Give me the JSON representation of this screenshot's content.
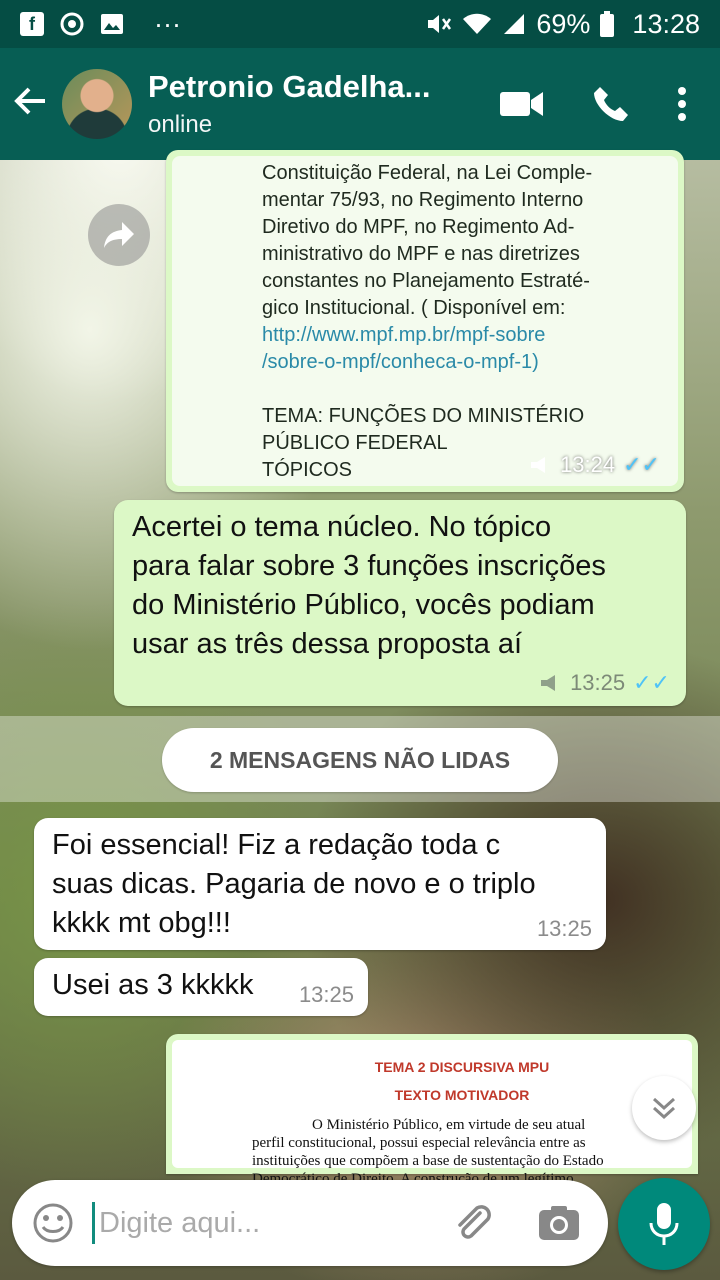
{
  "status_bar": {
    "icons": [
      "facebook-icon",
      "chrome-icon",
      "gallery-icon",
      "more-dots-icon"
    ],
    "more": "···",
    "battery": "69%",
    "time": "13:28"
  },
  "header": {
    "name": "Petronio Gadelha...",
    "presence": "online"
  },
  "messages": [
    {
      "type": "image",
      "direction": "out",
      "text_lines": [
        "Constituição Federal, na Lei Comple-",
        "mentar 75/93, no Regimento Interno",
        "Diretivo do MPF, no Regimento Ad-",
        "ministrativo do MPF e nas diretrizes",
        "constantes no Planejamento Estraté-",
        "gico Institucional.  ( Disponível em:",
        "http://www.mpf.mp.br/mpf-sobre",
        "/sobre-o-mpf/conheca-o-mpf-1)",
        "",
        "TEMA: FUNÇÕES DO MINISTÉRIO",
        "PÚBLICO FEDERAL",
        "TÓPICOS"
      ],
      "time": "13:24"
    },
    {
      "type": "text",
      "direction": "out",
      "lines": [
        "Acertei o tema núcleo.  No tópico",
        "para falar sobre 3 funções  inscrições",
        "do Ministério  Público,  vocês podiam",
        "usar as três  dessa proposta aí"
      ],
      "time": "13:25"
    },
    {
      "type": "text",
      "direction": "in",
      "lines": [
        "Foi essencial! Fiz a redação toda c",
        "suas dicas. Pagaria de novo e o triplo",
        "kkkk mt obg!!!"
      ],
      "time": "13:25"
    },
    {
      "type": "text",
      "direction": "in",
      "lines": [
        "Usei as 3 kkkkk"
      ],
      "time": "13:25"
    },
    {
      "type": "image",
      "direction": "out",
      "title": "TEMA 2 DISCURSIVA  MPU",
      "subtitle": "TEXTO MOTIVADOR",
      "body_lines": [
        "O  Ministério Público, em virtude de seu atual",
        "perfil constitucional, possui especial relevância entre as",
        "instituições que compõem a base de sustentação do Estado",
        "Democrático de Direito. A construção de um legítimo"
      ]
    }
  ],
  "unread_banner": "2 MENSAGENS NÃO LIDAS",
  "composer": {
    "placeholder": "Digite aqui..."
  }
}
